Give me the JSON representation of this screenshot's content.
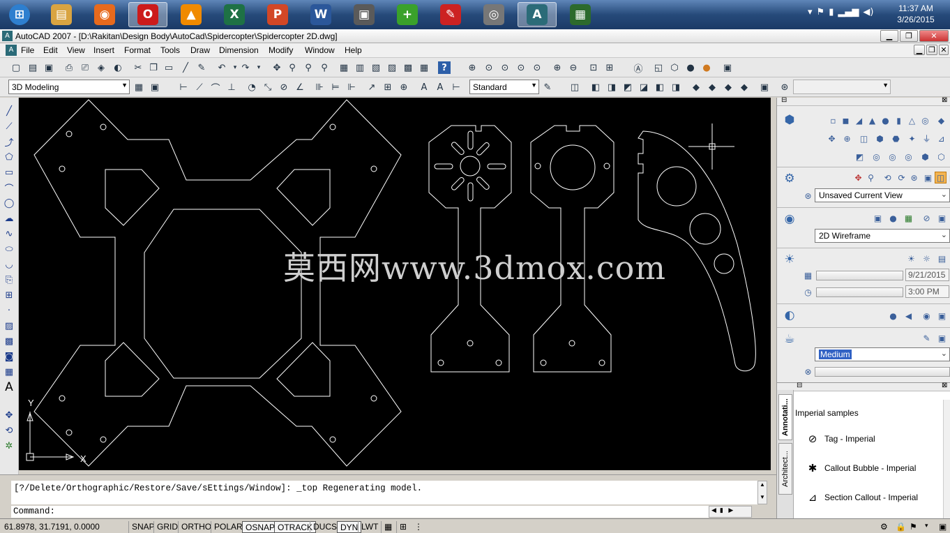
{
  "taskbar": {
    "apps": [
      {
        "name": "start-orb",
        "glyph": "⊞",
        "color": "#2e7fcf"
      },
      {
        "name": "explorer",
        "glyph": "▤",
        "color": "#d9a441"
      },
      {
        "name": "firefox",
        "glyph": "◉",
        "color": "#e76a1d"
      },
      {
        "name": "opera",
        "glyph": "O",
        "color": "#cc1b1b"
      },
      {
        "name": "vlc",
        "glyph": "▲",
        "color": "#f08a00"
      },
      {
        "name": "excel",
        "glyph": "X",
        "color": "#1e7145"
      },
      {
        "name": "powerpoint",
        "glyph": "P",
        "color": "#d24726"
      },
      {
        "name": "word",
        "glyph": "W",
        "color": "#2b579a"
      },
      {
        "name": "monitor",
        "glyph": "▣",
        "color": "#5a5a5a"
      },
      {
        "name": "app-plus",
        "glyph": "+",
        "color": "#3aa12b"
      },
      {
        "name": "app-feather",
        "glyph": "✎",
        "color": "#cc2222"
      },
      {
        "name": "media-disc",
        "glyph": "◎",
        "color": "#777777"
      },
      {
        "name": "autocad",
        "glyph": "A",
        "color": "#2b6b78"
      },
      {
        "name": "app-chart",
        "glyph": "▦",
        "color": "#2c6a2c"
      }
    ],
    "clock_time": "11:37 AM",
    "clock_date": "3/26/2015"
  },
  "window": {
    "title": "AutoCAD 2007 - [D:\\Rakitan\\Design Body\\AutoCad\\Spidercopter\\Spidercopter 2D.dwg]"
  },
  "menu": {
    "items": [
      "File",
      "Edit",
      "View",
      "Insert",
      "Format",
      "Tools",
      "Draw",
      "Dimension",
      "Modify",
      "Window",
      "Help"
    ]
  },
  "toolbar2": {
    "workspace": "3D Modeling",
    "text_style": "Standard"
  },
  "drawing": {
    "watermark": "莫西网www.3dmox.com",
    "ucs_x": "X",
    "ucs_y": "Y"
  },
  "dashboard": {
    "view_combo": "Unsaved Current View",
    "visual_style": "2D Wireframe",
    "date": "9/21/2015",
    "time": "3:00 PM",
    "quality": "Medium"
  },
  "palette": {
    "title": "Imperial samples",
    "tabs": [
      "Annotati...",
      "Architect..."
    ],
    "items": [
      {
        "label": "Tag - Imperial",
        "icon": "⊘"
      },
      {
        "label": "Callout Bubble - Imperial",
        "icon": "✱"
      },
      {
        "label": "Section Callout - Imperial",
        "icon": "⊿"
      }
    ]
  },
  "command": {
    "history": "[?/Delete/Orthographic/Restore/Save/sEttings/Window]: _top Regenerating model.",
    "prompt": "Command:"
  },
  "status": {
    "coords": "61.8978, 31.7191, 0.0000",
    "toggles": [
      {
        "label": "SNAP",
        "on": false
      },
      {
        "label": "GRID",
        "on": false
      },
      {
        "label": "ORTHO",
        "on": false
      },
      {
        "label": "POLAR",
        "on": false
      },
      {
        "label": "OSNAP",
        "on": true
      },
      {
        "label": "OTRACK",
        "on": true
      },
      {
        "label": "DUCS",
        "on": false
      },
      {
        "label": "DYN",
        "on": true
      },
      {
        "label": "LWT",
        "on": false
      }
    ]
  }
}
